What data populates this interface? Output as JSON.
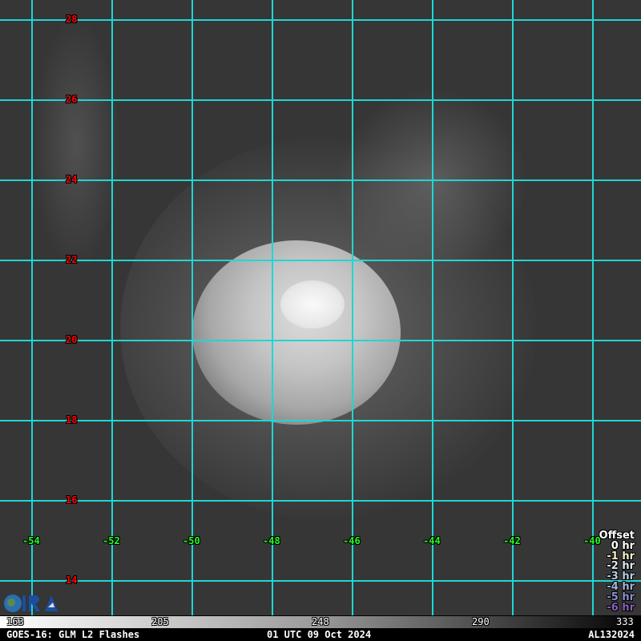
{
  "map": {
    "latitudes": [
      "28",
      "26",
      "24",
      "22",
      "20",
      "18",
      "16",
      "14"
    ],
    "longitudes": [
      "-54",
      "-52",
      "-50",
      "-48",
      "-46",
      "-44",
      "-42",
      "-40"
    ]
  },
  "legend": {
    "title": "Offset",
    "items": [
      {
        "label": "0 hr",
        "color": "#ffffff"
      },
      {
        "label": "-1 hr",
        "color": "#f4f0c8"
      },
      {
        "label": "-2 hr",
        "color": "#dde8ee"
      },
      {
        "label": "-3 hr",
        "color": "#b8cce0"
      },
      {
        "label": "-4 hr",
        "color": "#a0b4dc"
      },
      {
        "label": "-5 hr",
        "color": "#8c90d0"
      },
      {
        "label": "-6 hr",
        "color": "#8860b8"
      }
    ]
  },
  "colorbar": {
    "ticks": [
      "163",
      "205",
      "248",
      "290",
      "333"
    ]
  },
  "footer": {
    "left": "GOES-16: GLM L2 Flashes",
    "center": "01 UTC 09 Oct 2024",
    "right": "AL132024"
  },
  "logo": {
    "text": "CIRA"
  }
}
